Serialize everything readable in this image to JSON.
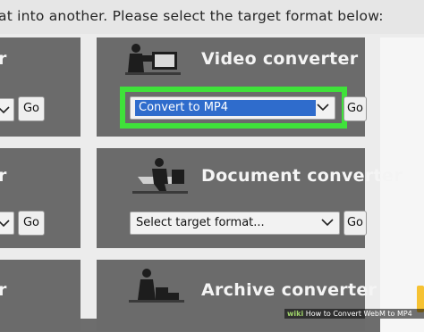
{
  "instruction_text": "at into another. Please select the target format below:",
  "left_column": {
    "frag_top": "r",
    "frag_mid": "r",
    "frag_bottom": "r",
    "go_label": "Go"
  },
  "video": {
    "title": "Video converter",
    "select_value": "Convert to MP4",
    "go_label": "Go",
    "highlight_color": "#3fe23a",
    "selection_color": "#2f6ccc"
  },
  "document": {
    "title": "Document converter",
    "select_value": "Select target format...",
    "go_label": "Go"
  },
  "archive": {
    "title": "Archive converter"
  },
  "watermark": {
    "brand": "wiki",
    "text": "How to Convert WebM to MP4"
  },
  "colors": {
    "panel": "#6b6b6b",
    "grid": "#ececec",
    "accent": "#f6c232"
  }
}
